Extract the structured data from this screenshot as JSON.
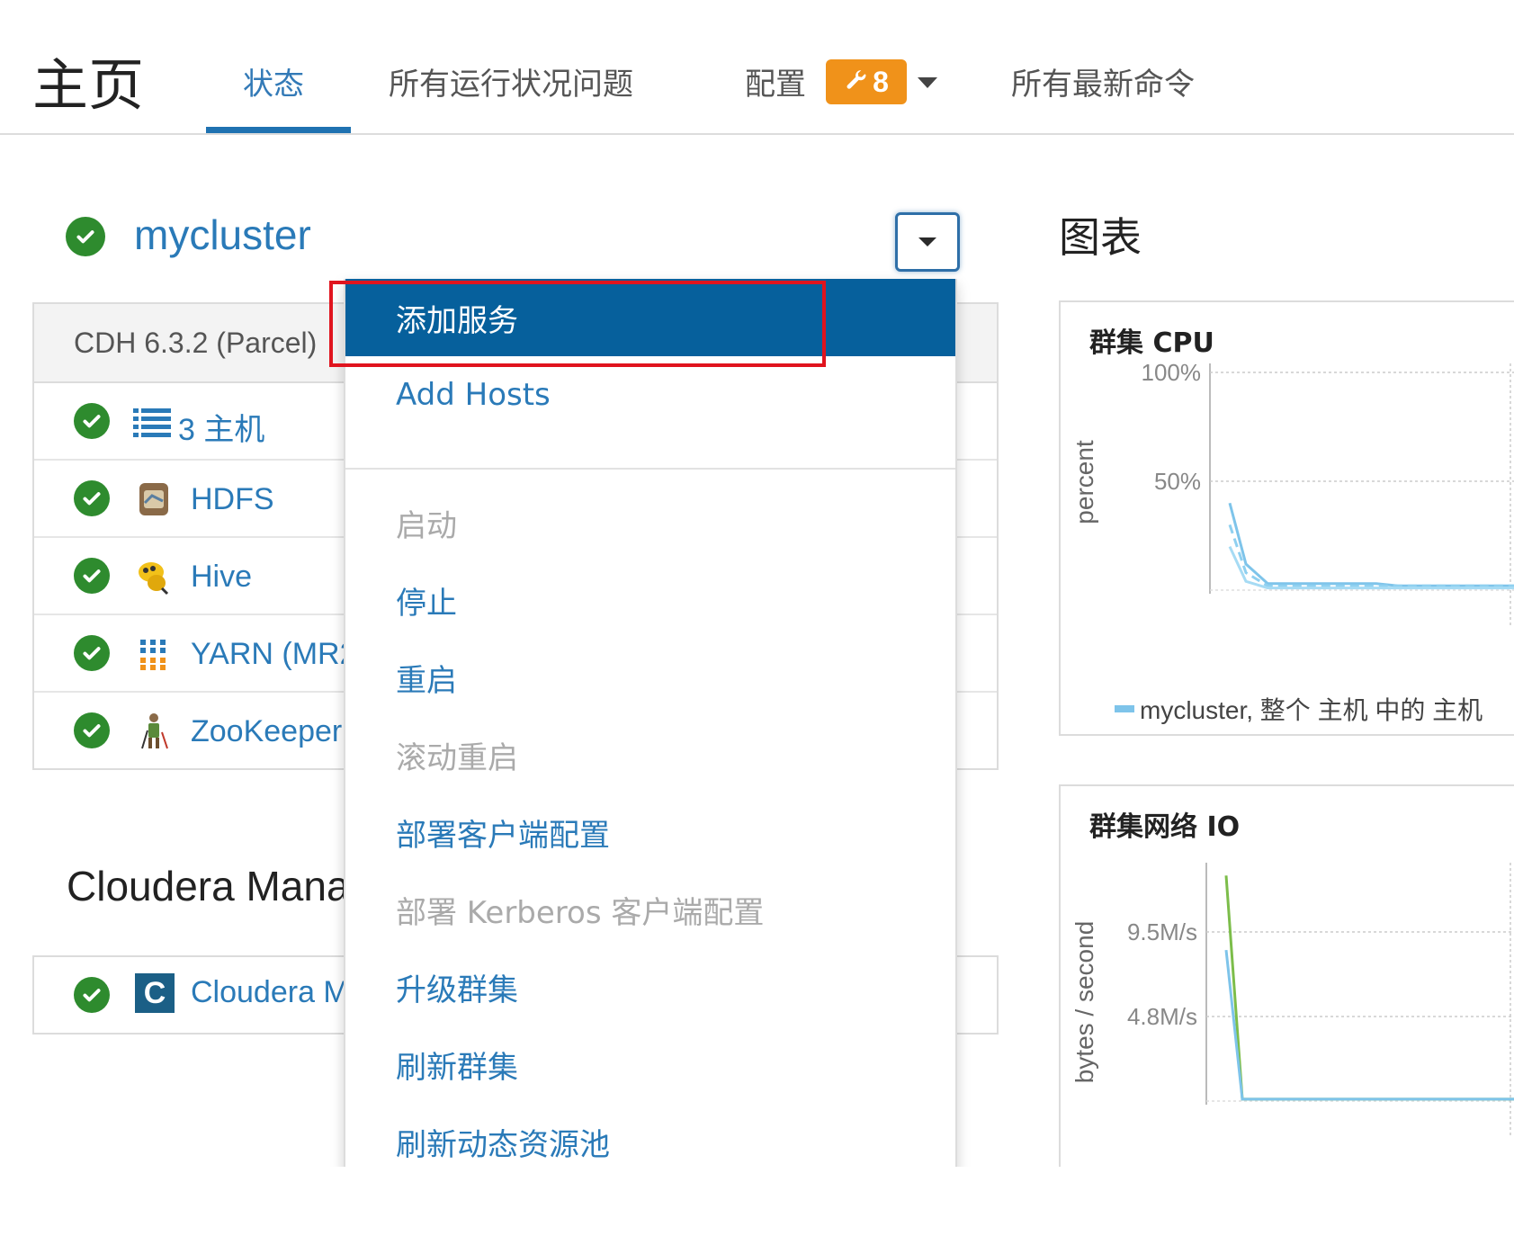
{
  "header": {
    "title": "主页",
    "tabs": [
      {
        "label": "状态",
        "active": true
      },
      {
        "label": "所有运行状况问题"
      },
      {
        "label": "配置"
      },
      {
        "label": "所有最新命令"
      }
    ],
    "config_badge": "8"
  },
  "cluster": {
    "name": "mycluster",
    "version": "CDH 6.3.2 (Parcel)",
    "services": [
      {
        "label": "3 主机",
        "icon": "hosts-icon"
      },
      {
        "label": "HDFS",
        "icon": "hdfs-icon"
      },
      {
        "label": "Hive",
        "icon": "hive-icon"
      },
      {
        "label": "YARN (MR2",
        "icon": "yarn-icon"
      },
      {
        "label": "ZooKeeper",
        "icon": "zookeeper-icon"
      }
    ]
  },
  "cloudera_manager": {
    "title": "Cloudera Mana",
    "row_label": "Cloudera M",
    "logo_letter": "C"
  },
  "menu": {
    "items": [
      {
        "label": "添加服务",
        "state": "active"
      },
      {
        "label": "Add Hosts",
        "state": "enabled"
      },
      {
        "label": "启动",
        "state": "disabled"
      },
      {
        "label": "停止",
        "state": "enabled"
      },
      {
        "label": "重启",
        "state": "enabled"
      },
      {
        "label": "滚动重启",
        "state": "disabled"
      },
      {
        "label": "部署客户端配置",
        "state": "enabled"
      },
      {
        "label": "部署 Kerberos 客户端配置",
        "state": "disabled"
      },
      {
        "label": "升级群集",
        "state": "enabled"
      },
      {
        "label": "刷新群集",
        "state": "enabled"
      },
      {
        "label": "刷新动态资源池",
        "state": "enabled"
      }
    ]
  },
  "charts": {
    "title": "图表",
    "cpu": {
      "title": "群集 CPU",
      "ylabel": "percent",
      "ticks": [
        "100%",
        "50%"
      ],
      "legend": "mycluster, 整个 主机 中的 主机"
    },
    "network": {
      "title": "群集网络 IO",
      "ylabel": "bytes / second",
      "ticks": [
        "9.5M/s",
        "4.8M/s"
      ]
    }
  },
  "chart_data": [
    {
      "type": "line",
      "title": "群集 CPU",
      "ylabel": "percent",
      "ylim": [
        0,
        100
      ],
      "yticks": [
        "100%",
        "50%"
      ],
      "series": [
        {
          "name": "mycluster, 整个 主机 中的 主机",
          "values": [
            40,
            12,
            3,
            3,
            3,
            3,
            3,
            3,
            2,
            2,
            2,
            2,
            2,
            2,
            2
          ]
        },
        {
          "values": [
            30,
            8,
            2,
            2,
            2,
            2,
            2,
            2,
            2,
            2,
            2,
            2,
            2,
            2,
            2
          ]
        },
        {
          "values": [
            20,
            4,
            1,
            1,
            1,
            1,
            1,
            1,
            1,
            1,
            1,
            1,
            1,
            1,
            1
          ]
        }
      ]
    },
    {
      "type": "line",
      "title": "群集网络 IO",
      "ylabel": "bytes / second",
      "yticks": [
        "9.5M/s",
        "4.8M/s"
      ],
      "ylim": [
        0,
        12000000
      ],
      "series": [
        {
          "values": [
            11800000,
            100000,
            100000,
            100000,
            100000,
            100000
          ]
        },
        {
          "values": [
            7900000,
            100000,
            100000,
            100000,
            100000,
            100000
          ]
        }
      ]
    }
  ]
}
